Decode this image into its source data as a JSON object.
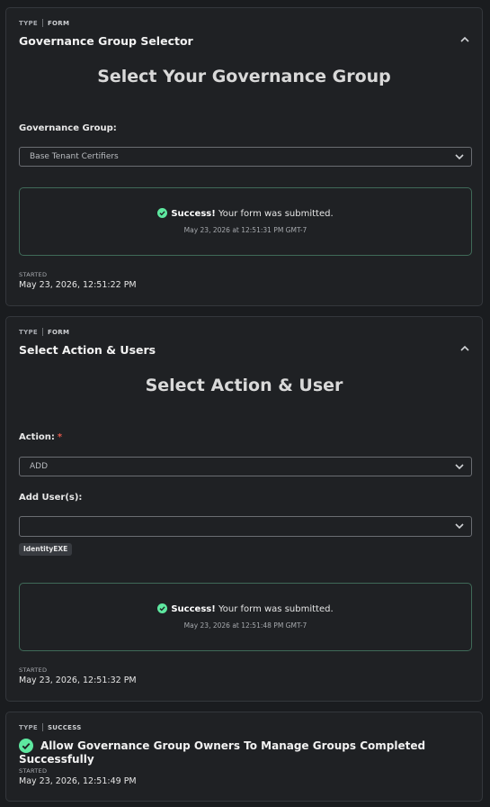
{
  "cards": [
    {
      "type_label": "TYPE",
      "type_value": "FORM",
      "title": "Governance Group Selector",
      "heading": "Select Your Governance Group",
      "field_label": "Governance Group:",
      "select_value": "Base Tenant Certifiers",
      "success_strong": "Success!",
      "success_text": "Your form was submitted.",
      "success_date": "May 23, 2026 at 12:51:31 PM GMT-7",
      "started_label": "STARTED",
      "started_value": "May 23, 2026, 12:51:22 PM"
    },
    {
      "type_label": "TYPE",
      "type_value": "FORM",
      "title": "Select Action & Users",
      "heading": "Select Action & User",
      "action_label": "Action:",
      "action_required": "*",
      "action_value": "ADD",
      "users_label": "Add User(s):",
      "users_value": "",
      "user_chip": "IdentityEXE",
      "success_strong": "Success!",
      "success_text": "Your form was submitted.",
      "success_date": "May 23, 2026 at 12:51:48 PM GMT-7",
      "started_label": "STARTED",
      "started_value": "May 23, 2026, 12:51:32 PM"
    },
    {
      "type_label": "TYPE",
      "type_value": "SUCCESS",
      "title": "Allow Governance Group Owners To Manage Groups Completed Successfully",
      "started_label": "STARTED",
      "started_value": "May 23, 2026, 12:51:49 PM"
    }
  ],
  "colors": {
    "background": "#1a1c1f",
    "card": "#1f2124",
    "success_green": "#5ee8a0",
    "success_border": "#3f6a58",
    "required_red": "#e0584b"
  },
  "icons": [
    "chevron-up-icon",
    "chevron-down-icon",
    "check-circle-icon"
  ]
}
